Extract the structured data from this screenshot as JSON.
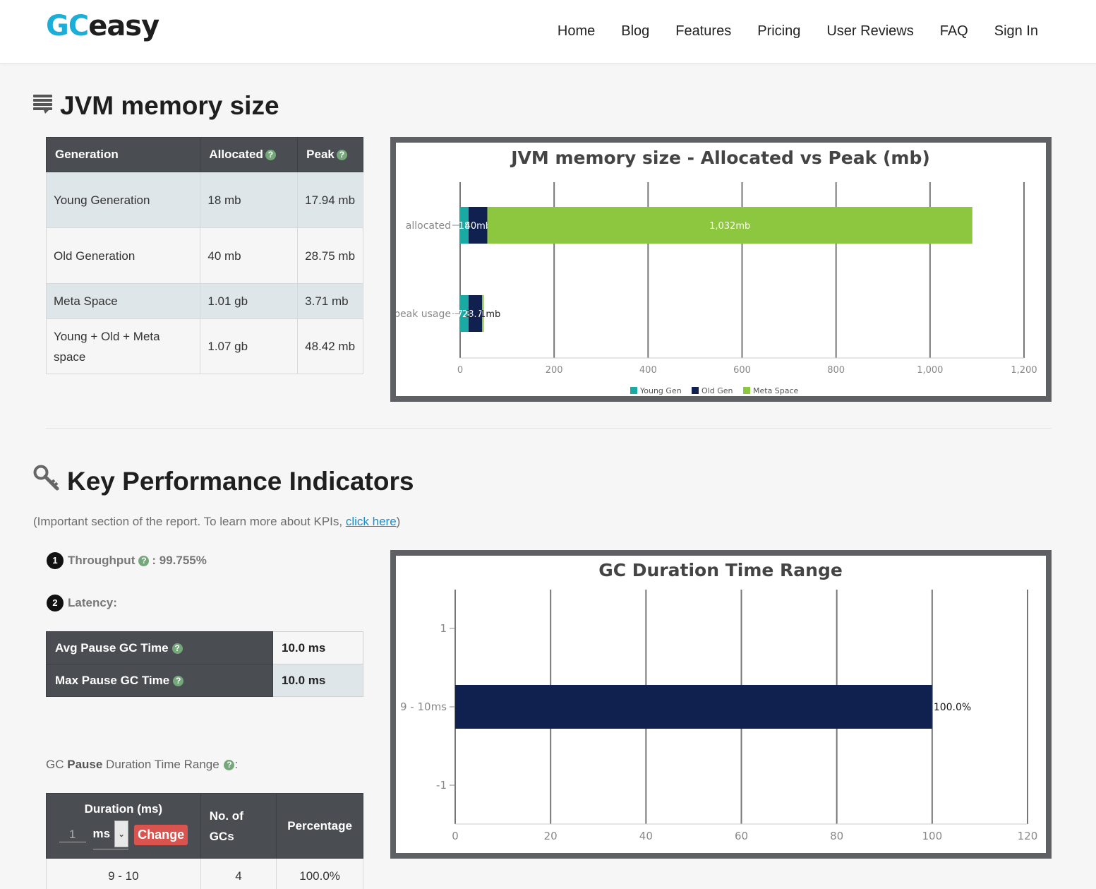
{
  "header": {
    "logo_gc": "GC",
    "logo_easy": "easy",
    "nav": [
      "Home",
      "Blog",
      "Features",
      "Pricing",
      "User Reviews",
      "FAQ",
      "Sign In"
    ]
  },
  "memory_section": {
    "title": "JVM memory size",
    "table": {
      "headers": [
        "Generation",
        "Allocated",
        "Peak"
      ],
      "rows": [
        {
          "generation": "Young Generation",
          "allocated": "18 mb",
          "peak": "17.94 mb"
        },
        {
          "generation": "Old Generation",
          "allocated": "40 mb",
          "peak": "28.75 mb"
        },
        {
          "generation": "Meta Space",
          "allocated": "1.01 gb",
          "peak": "3.71 mb"
        },
        {
          "generation": "Young + Old + Meta space",
          "allocated": "1.07 gb",
          "peak": "48.42 mb"
        }
      ]
    }
  },
  "kpi_section": {
    "title": "Key Performance Indicators",
    "subtext_before": "(Important section of the report. To learn more about KPIs, ",
    "subtext_link": "click here",
    "subtext_after": ")",
    "throughput_num": "1",
    "throughput_label": "Throughput",
    "throughput_value": ": 99.755%",
    "latency_num": "2",
    "latency_label": "Latency:",
    "latency_rows": [
      {
        "label": "Avg Pause GC Time",
        "value": "10.0 ms"
      },
      {
        "label": "Max Pause GC Time",
        "value": "10.0 ms"
      }
    ],
    "range_label_a": "GC ",
    "range_label_b": "Pause",
    "range_label_c": " Duration Time Range",
    "range_label_d": ":",
    "duration_table": {
      "col1": "Duration (ms)",
      "col2_line1": "No. of",
      "col2_line2": "GCs",
      "col3": "Percentage",
      "unit_input_placeholder": "1",
      "unit_select": "ms",
      "change_button": "Change",
      "rows": [
        {
          "duration": "9 - 10",
          "count": "4",
          "percentage": "100.0%"
        }
      ]
    }
  },
  "chart_data": [
    {
      "type": "bar",
      "orientation": "horizontal",
      "stacked": true,
      "title": "JVM memory size - Allocated vs Peak (mb)",
      "categories": [
        "allocated",
        "peak usage"
      ],
      "series": [
        {
          "name": "Young Gen",
          "values": [
            18,
            17.94
          ],
          "color": "#1aaaa4",
          "labels": [
            "18",
            "17.94"
          ]
        },
        {
          "name": "Old Gen",
          "values": [
            40,
            28.75
          ],
          "color": "#11214f",
          "labels": [
            "40mb",
            "28.75"
          ]
        },
        {
          "name": "Meta Space",
          "values": [
            1032,
            3.71
          ],
          "color": "#8dc63f",
          "labels": [
            "1,032mb",
            "3.71mb"
          ]
        }
      ],
      "xlim": [
        0,
        1200
      ],
      "xticks": [
        "0",
        "200",
        "400",
        "600",
        "800",
        "1,000",
        "1,200"
      ],
      "legend": "bottom"
    },
    {
      "type": "bar",
      "orientation": "horizontal",
      "title": "GC Duration Time Range",
      "categories": [
        "9 - 10ms"
      ],
      "values": [
        100.0
      ],
      "value_labels": [
        "100.0%"
      ],
      "color": "#11214f",
      "xlim": [
        0,
        120
      ],
      "xticks": [
        "0",
        "20",
        "40",
        "60",
        "80",
        "100",
        "120"
      ],
      "yticks": [
        "1",
        "9 - 10ms",
        "-1"
      ]
    }
  ]
}
